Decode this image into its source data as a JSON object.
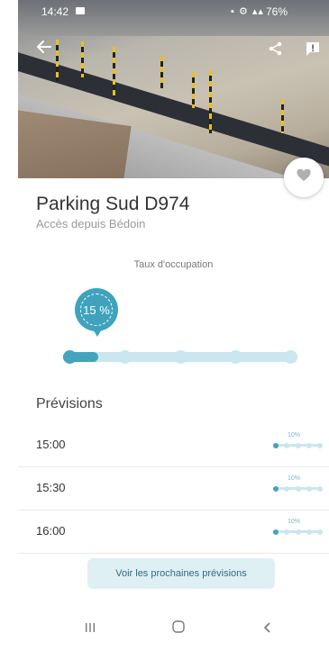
{
  "status_bar": {
    "time": "14:42",
    "battery": "76%"
  },
  "header": {
    "title": "Parking Sud D974",
    "subtitle": "Accès depuis Bédoin"
  },
  "occupancy": {
    "label": "Taux d'occupation",
    "value_label": "15 %",
    "value": 0.15,
    "steps": 5
  },
  "forecasts": {
    "title": "Prévisions",
    "items": [
      {
        "time": "15:00",
        "percent_label": "10%",
        "value": 0.1
      },
      {
        "time": "15:30",
        "percent_label": "10%",
        "value": 0.1
      },
      {
        "time": "16:00",
        "percent_label": "10%",
        "value": 0.1
      }
    ],
    "more_button": "Voir les prochaines prévisions"
  },
  "icons": {
    "back": "back-arrow-icon",
    "share": "share-icon",
    "report": "report-icon",
    "favorite": "heart-icon"
  },
  "colors": {
    "accent": "#3fa3bd",
    "track": "#cbe6ee",
    "button_bg": "#dff0f5"
  }
}
